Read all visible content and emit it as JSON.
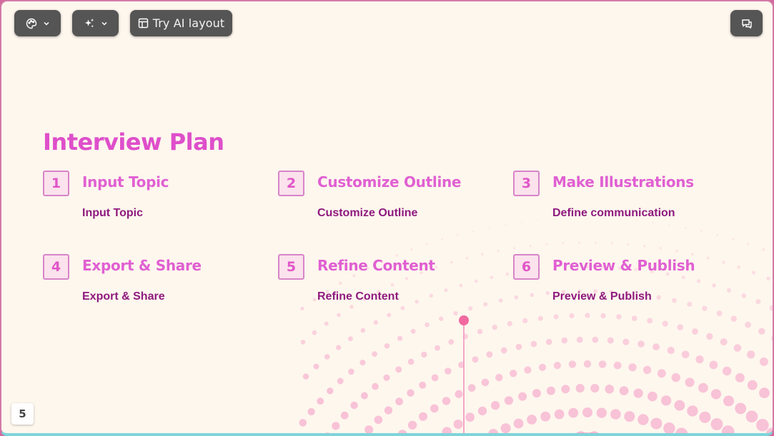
{
  "toolbar": {
    "theme_icon": "palette-icon",
    "ai_icon": "sparkles-icon",
    "layout_icon": "layout-icon",
    "layout_label": "Try AI layout",
    "comment_icon": "comment-icon"
  },
  "slide": {
    "title": "Interview Plan",
    "steps": [
      {
        "num": "1",
        "title": "Input Topic",
        "desc": "Input Topic"
      },
      {
        "num": "2",
        "title": "Customize Outline",
        "desc": "Customize Outline"
      },
      {
        "num": "3",
        "title": "Make Illustrations",
        "desc": "Define communication"
      },
      {
        "num": "4",
        "title": "Export & Share",
        "desc": "Export & Share"
      },
      {
        "num": "5",
        "title": "Refine Content",
        "desc": "Refine Content"
      },
      {
        "num": "6",
        "title": "Preview & Publish",
        "desc": "Preview & Publish"
      }
    ]
  },
  "page_number": "5",
  "colors": {
    "background": "#fef7ee",
    "accent": "#e060d2",
    "description": "#8e1a7e",
    "dots": "#f7b8d2"
  }
}
